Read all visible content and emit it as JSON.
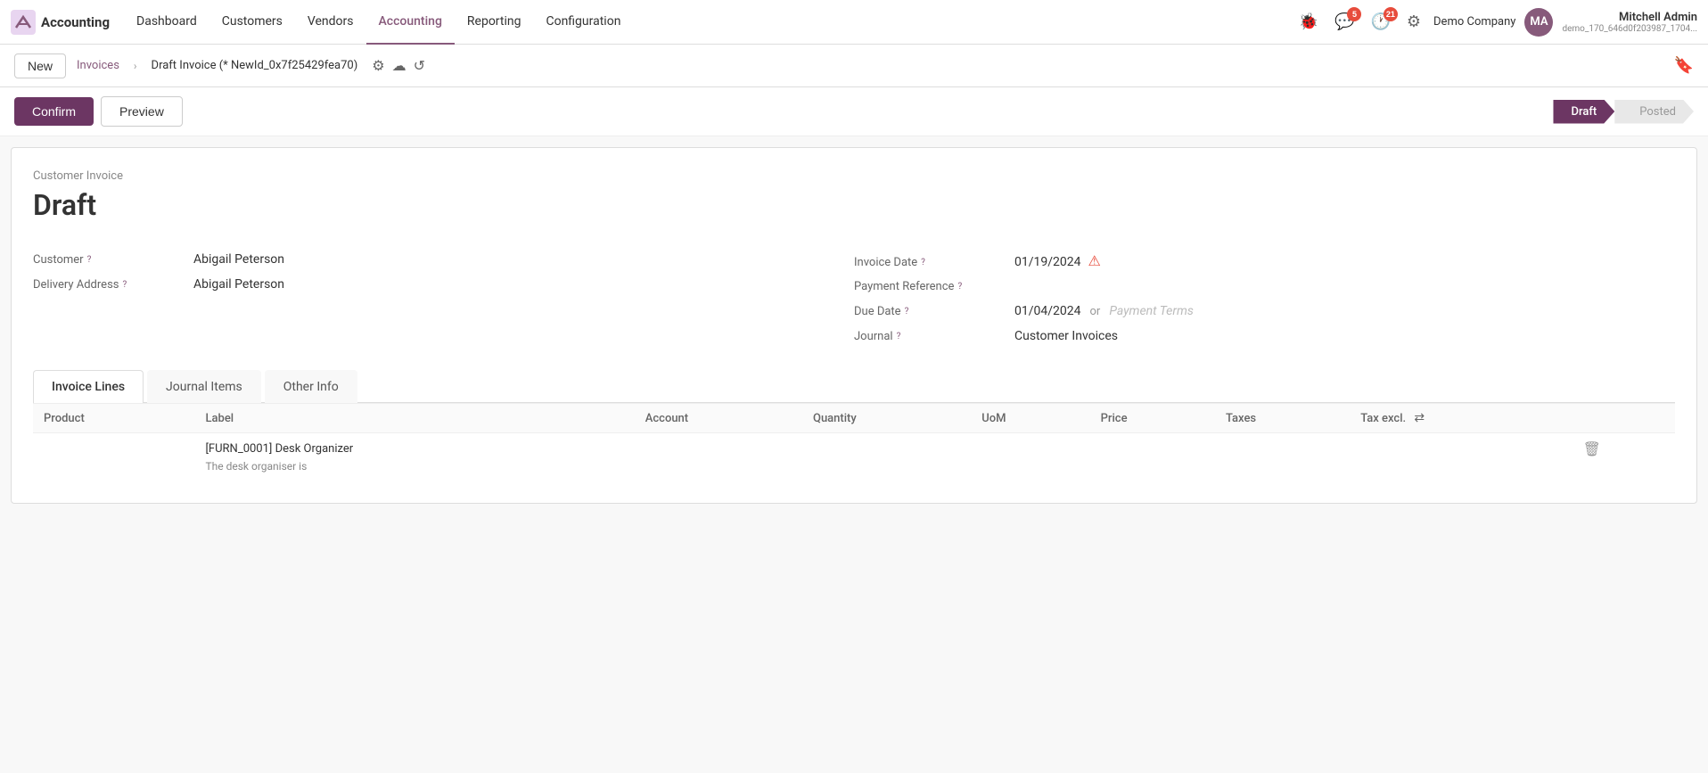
{
  "topnav": {
    "logo_text": "Accounting",
    "menu_items": [
      {
        "label": "Dashboard",
        "active": false
      },
      {
        "label": "Customers",
        "active": false
      },
      {
        "label": "Vendors",
        "active": false
      },
      {
        "label": "Accounting",
        "active": true
      },
      {
        "label": "Reporting",
        "active": false
      },
      {
        "label": "Configuration",
        "active": false
      }
    ],
    "notification_count": "5",
    "clock_count": "21",
    "company": "Demo Company",
    "user_name": "Mitchell Admin",
    "user_db": "demo_170_646d0f203987_1704...",
    "avatar_initials": "MA"
  },
  "breadcrumb": {
    "parent": "Invoices",
    "current": "Draft Invoice (* NewId_0x7f25429fea70)"
  },
  "toolbar": {
    "new_label": "New"
  },
  "actions": {
    "confirm_label": "Confirm",
    "preview_label": "Preview"
  },
  "status": {
    "draft_label": "Draft",
    "posted_label": "Posted"
  },
  "form": {
    "invoice_type": "Customer Invoice",
    "status_title": "Draft",
    "customer_label": "Customer",
    "customer_value": "Abigail Peterson",
    "delivery_address_label": "Delivery Address",
    "delivery_address_value": "Abigail Peterson",
    "invoice_date_label": "Invoice Date",
    "invoice_date_value": "01/19/2024",
    "payment_reference_label": "Payment Reference",
    "payment_reference_value": "",
    "due_date_label": "Due Date",
    "due_date_value": "01/04/2024",
    "due_date_or": "or",
    "payment_terms_placeholder": "Payment Terms",
    "journal_label": "Journal",
    "journal_value": "Customer Invoices"
  },
  "tabs": [
    {
      "label": "Invoice Lines",
      "active": true
    },
    {
      "label": "Journal Items",
      "active": false
    },
    {
      "label": "Other Info",
      "active": false
    }
  ],
  "table": {
    "columns": [
      "Product",
      "Label",
      "Account",
      "Quantity",
      "UoM",
      "Price",
      "Taxes",
      "Tax excl."
    ],
    "rows": [
      {
        "product": "",
        "label_main": "[FURN_0001] Desk Organizer",
        "label_desc": "The desk organiser is",
        "account": "",
        "quantity": "",
        "uom": "",
        "price": "",
        "taxes": "",
        "tax_excl": ""
      }
    ]
  }
}
